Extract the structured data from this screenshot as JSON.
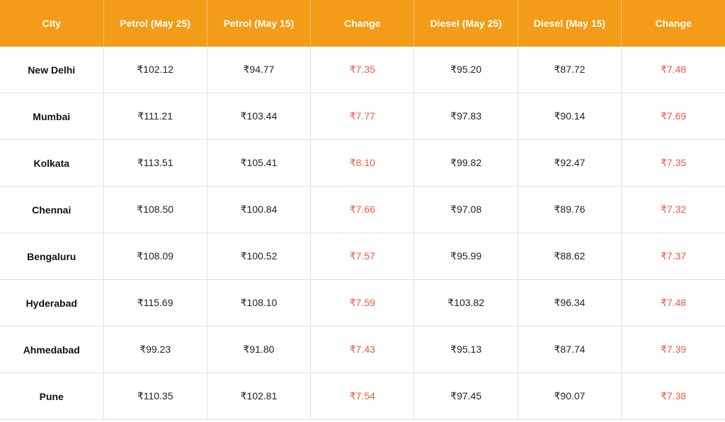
{
  "chart_data": {
    "type": "table",
    "headers": [
      "City",
      "Petrol (May 25)",
      "Petrol (May 15)",
      "Change",
      "Diesel (May 25)",
      "Diesel (May 15)",
      "Change"
    ],
    "rows": [
      [
        "New Delhi",
        "₹102.12",
        "₹94.77",
        "₹7.35",
        "₹95.20",
        "₹87.72",
        "₹7.48"
      ],
      [
        "Mumbai",
        "₹111.21",
        "₹103.44",
        "₹7.77",
        "₹97.83",
        "₹90.14",
        "₹7.69"
      ],
      [
        "Kolkata",
        "₹113.51",
        "₹105.41",
        "₹8.10",
        "₹99.82",
        "₹92.47",
        "₹7.35"
      ],
      [
        "Chennai",
        "₹108.50",
        "₹100.84",
        "₹7.66",
        "₹97.08",
        "₹89.76",
        "₹7.32"
      ],
      [
        "Bengaluru",
        "₹108.09",
        "₹100.52",
        "₹7.57",
        "₹95.99",
        "₹88.62",
        "₹7.37"
      ],
      [
        "Hyderabad",
        "₹115.69",
        "₹108.10",
        "₹7.59",
        "₹103.82",
        "₹96.34",
        "₹7.48"
      ],
      [
        "Ahmedabad",
        "₹99.23",
        "₹91.80",
        "₹7.43",
        "₹95.13",
        "₹87.74",
        "₹7.39"
      ],
      [
        "Pune",
        "₹110.35",
        "₹102.81",
        "₹7.54",
        "₹97.45",
        "₹90.07",
        "₹7.38"
      ]
    ],
    "colors": {
      "header_background": "#f39c17",
      "header_text": "#ffffff",
      "change_text": "#ee5a3a"
    }
  }
}
